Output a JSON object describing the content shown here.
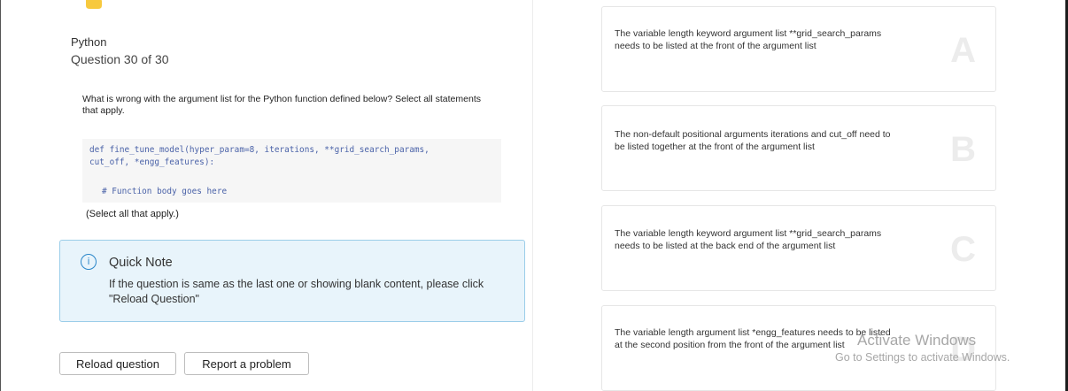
{
  "question": {
    "subject": "Python",
    "counter": "Question 30 of 30",
    "prompt": "What is wrong with the argument list for the Python function defined below? Select all statements that apply.",
    "code_line_1": "def fine_tune_model(hyper_param=8, iterations, **grid_search_params,",
    "code_line_2": "cut_off, *engg_features):",
    "code_comment": "# Function body goes here",
    "select_hint": "(Select all that apply.)"
  },
  "note": {
    "icon": "info-icon",
    "title": "Quick Note",
    "body": "If the question is same as the last one or showing blank content, please click \"Reload Question\""
  },
  "buttons": {
    "reload": "Reload question",
    "report": "Report a problem"
  },
  "options": [
    {
      "letter": "A",
      "text": "The variable length keyword argument list **grid_search_params needs to be listed at the front of the argument list"
    },
    {
      "letter": "B",
      "text": "The non-default positional arguments iterations and cut_off need to be listed together at the front of the argument list"
    },
    {
      "letter": "C",
      "text": "The variable length keyword argument list **grid_search_params needs to be listed at the back end of the argument list"
    },
    {
      "letter": "D",
      "text": "The variable length argument list *engg_features needs to be listed at the second position from the front of the argument list"
    }
  ],
  "watermark": {
    "title": "Activate Windows",
    "subtitle": "Go to Settings to activate Windows."
  },
  "colors": {
    "note_bg": "#e8f4fb",
    "note_border": "#9bcde9",
    "code_text": "#4a62a8",
    "letter_watermark": "#ececec"
  }
}
